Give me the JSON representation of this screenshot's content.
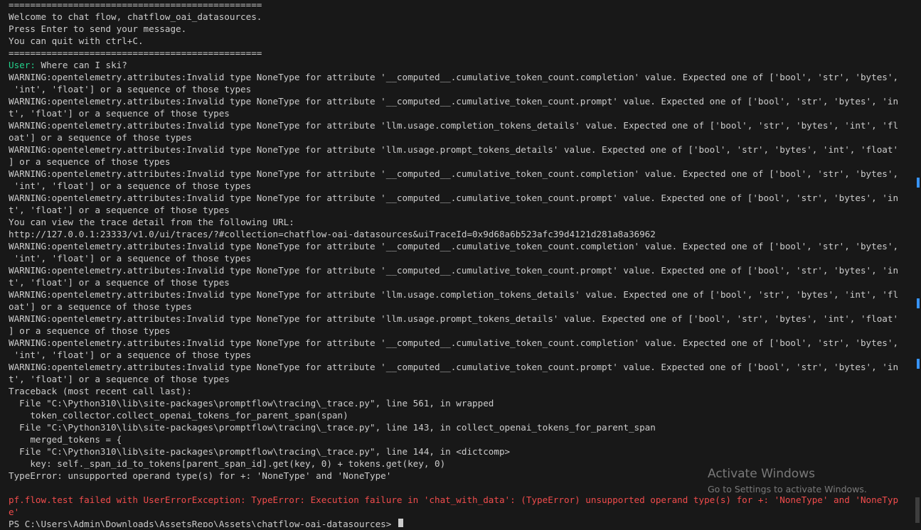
{
  "terminal": {
    "lines": [
      {
        "text": "==============================================="
      },
      {
        "text": "Welcome to chat flow, chatflow_oai_datasources."
      },
      {
        "text": "Press Enter to send your message."
      },
      {
        "text": "You can quit with ctrl+C."
      },
      {
        "text": "==============================================="
      },
      {
        "prefix": "User:",
        "text": " Where can I ski?"
      },
      {
        "text": "WARNING:opentelemetry.attributes:Invalid type NoneType for attribute '__computed__.cumulative_token_count.completion' value. Expected one of ['bool', 'str', 'bytes',"
      },
      {
        "text": " 'int', 'float'] or a sequence of those types"
      },
      {
        "text": "WARNING:opentelemetry.attributes:Invalid type NoneType for attribute '__computed__.cumulative_token_count.prompt' value. Expected one of ['bool', 'str', 'bytes', 'in"
      },
      {
        "text": "t', 'float'] or a sequence of those types"
      },
      {
        "text": "WARNING:opentelemetry.attributes:Invalid type NoneType for attribute 'llm.usage.completion_tokens_details' value. Expected one of ['bool', 'str', 'bytes', 'int', 'fl"
      },
      {
        "text": "oat'] or a sequence of those types"
      },
      {
        "text": "WARNING:opentelemetry.attributes:Invalid type NoneType for attribute 'llm.usage.prompt_tokens_details' value. Expected one of ['bool', 'str', 'bytes', 'int', 'float'"
      },
      {
        "text": "] or a sequence of those types"
      },
      {
        "text": "WARNING:opentelemetry.attributes:Invalid type NoneType for attribute '__computed__.cumulative_token_count.completion' value. Expected one of ['bool', 'str', 'bytes',"
      },
      {
        "text": " 'int', 'float'] or a sequence of those types"
      },
      {
        "text": "WARNING:opentelemetry.attributes:Invalid type NoneType for attribute '__computed__.cumulative_token_count.prompt' value. Expected one of ['bool', 'str', 'bytes', 'in"
      },
      {
        "text": "t', 'float'] or a sequence of those types"
      },
      {
        "text": "You can view the trace detail from the following URL:"
      },
      {
        "text": "http://127.0.0.1:23333/v1.0/ui/traces/?#collection=chatflow-oai-datasources&uiTraceId=0x9d68a6b523afc39d4121d281a8a36962"
      },
      {
        "text": "WARNING:opentelemetry.attributes:Invalid type NoneType for attribute '__computed__.cumulative_token_count.completion' value. Expected one of ['bool', 'str', 'bytes',"
      },
      {
        "text": " 'int', 'float'] or a sequence of those types"
      },
      {
        "text": "WARNING:opentelemetry.attributes:Invalid type NoneType for attribute '__computed__.cumulative_token_count.prompt' value. Expected one of ['bool', 'str', 'bytes', 'in"
      },
      {
        "text": "t', 'float'] or a sequence of those types"
      },
      {
        "text": "WARNING:opentelemetry.attributes:Invalid type NoneType for attribute 'llm.usage.completion_tokens_details' value. Expected one of ['bool', 'str', 'bytes', 'int', 'fl"
      },
      {
        "text": "oat'] or a sequence of those types"
      },
      {
        "text": "WARNING:opentelemetry.attributes:Invalid type NoneType for attribute 'llm.usage.prompt_tokens_details' value. Expected one of ['bool', 'str', 'bytes', 'int', 'float'"
      },
      {
        "text": "] or a sequence of those types"
      },
      {
        "text": "WARNING:opentelemetry.attributes:Invalid type NoneType for attribute '__computed__.cumulative_token_count.completion' value. Expected one of ['bool', 'str', 'bytes',"
      },
      {
        "text": " 'int', 'float'] or a sequence of those types"
      },
      {
        "text": "WARNING:opentelemetry.attributes:Invalid type NoneType for attribute '__computed__.cumulative_token_count.prompt' value. Expected one of ['bool', 'str', 'bytes', 'in"
      },
      {
        "text": "t', 'float'] or a sequence of those types"
      },
      {
        "text": "Traceback (most recent call last):"
      },
      {
        "text": "  File \"C:\\Python310\\lib\\site-packages\\promptflow\\tracing\\_trace.py\", line 561, in wrapped"
      },
      {
        "text": "    token_collector.collect_openai_tokens_for_parent_span(span)"
      },
      {
        "text": "  File \"C:\\Python310\\lib\\site-packages\\promptflow\\tracing\\_trace.py\", line 143, in collect_openai_tokens_for_parent_span"
      },
      {
        "text": "    merged_tokens = {"
      },
      {
        "text": "  File \"C:\\Python310\\lib\\site-packages\\promptflow\\tracing\\_trace.py\", line 144, in <dictcomp>"
      },
      {
        "text": "    key: self._span_id_to_tokens[parent_span_id].get(key, 0) + tokens.get(key, 0)"
      },
      {
        "text": "TypeError: unsupported operand type(s) for +: 'NoneType' and 'NoneType'"
      },
      {
        "text": ""
      },
      {
        "text": "pf.flow.test failed with UserErrorException: TypeError: Execution failure in 'chat_with_data': (TypeError) unsupported operand type(s) for +: 'NoneType' and 'NoneTyp",
        "style": "error"
      },
      {
        "text": "e'",
        "style": "error"
      },
      {
        "text": "PS C:\\Users\\Admin\\Downloads\\AssetsRepo\\Assets\\chatflow-oai-datasources> ",
        "prompt": true
      }
    ]
  },
  "watermark": {
    "title": "Activate Windows",
    "subtitle": "Go to Settings to activate Windows."
  },
  "colors": {
    "background": "#181818",
    "foreground": "#cccccc",
    "user_prefix": "#23d18b",
    "error": "#f14c4c"
  }
}
